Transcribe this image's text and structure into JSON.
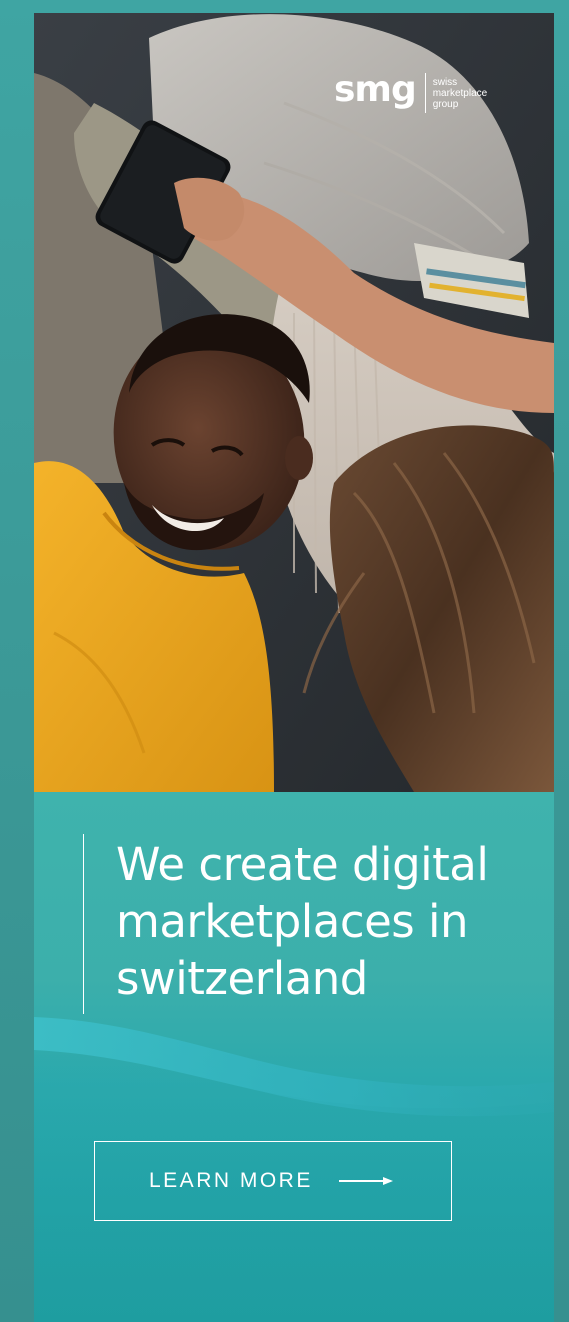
{
  "brand": {
    "logo_word": "smg",
    "logo_lines": [
      "swiss",
      "marketplace",
      "group"
    ]
  },
  "headline": {
    "lines": [
      "We create digital",
      "marketplaces in",
      "switzerland"
    ]
  },
  "cta": {
    "label": "LEARN MORE",
    "icon": "arrow-right-icon"
  },
  "colors": {
    "panel_teal": "#2fa6a6",
    "page_background": "#3e9a98",
    "text": "#ffffff"
  }
}
